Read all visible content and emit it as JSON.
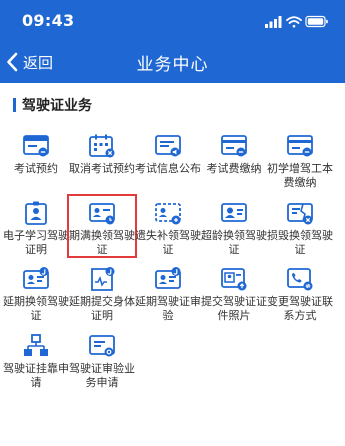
{
  "status": {
    "time": "09:43"
  },
  "nav": {
    "back_label": "返回",
    "title": "业务中心"
  },
  "section": {
    "title": "驾驶证业务"
  },
  "colors": {
    "primary": "#1f67d2",
    "selection": "#e33b3b"
  },
  "items": [
    {
      "key": "exam-booking",
      "label": "考试预约",
      "icon": "card-minus-icon"
    },
    {
      "key": "cancel-exam-booking",
      "label": "取消考试预约",
      "icon": "calendar-cancel-icon"
    },
    {
      "key": "exam-info-publish",
      "label": "考试信息公布",
      "icon": "card-speaker-icon"
    },
    {
      "key": "exam-fee-payment",
      "label": "考试费缴纳",
      "icon": "card-lines-icon"
    },
    {
      "key": "new-driver-fee",
      "label": "初学增驾工本费缴纳",
      "icon": "card-lines-icon"
    },
    {
      "key": "e-study-license",
      "label": "电子学习驾驶证明",
      "icon": "id-badge-icon"
    },
    {
      "key": "expiry-renewal",
      "label": "期满换领驾驶证",
      "icon": "license-clock-icon",
      "selected": true
    },
    {
      "key": "lost-reissue",
      "label": "遗失补领驾驶证",
      "icon": "license-lost-icon"
    },
    {
      "key": "over-age-renewal",
      "label": "超龄换领驾驶证",
      "icon": "license-person-icon"
    },
    {
      "key": "damaged-renewal",
      "label": "损毁换领驾驶证",
      "icon": "license-broken-icon"
    },
    {
      "key": "extend-renewal",
      "label": "延期换领驾驶证",
      "icon": "license-j-icon"
    },
    {
      "key": "extend-health-proof",
      "label": "延期提交身体证明",
      "icon": "health-cert-icon"
    },
    {
      "key": "extend-license-review",
      "label": "延期驾驶证审验",
      "icon": "license-j-icon"
    },
    {
      "key": "submit-license-photo",
      "label": "提交驾驶证证件照片",
      "icon": "photo-upload-icon"
    },
    {
      "key": "change-contact",
      "label": "变更驾驶证联系方式",
      "icon": "phone-change-icon"
    },
    {
      "key": "license-affiliation",
      "label": "驾驶证挂靠申请",
      "icon": "org-chart-icon"
    },
    {
      "key": "review-business-apply",
      "label": "驾驶证审验业务申请",
      "icon": "card-gear-icon"
    }
  ]
}
